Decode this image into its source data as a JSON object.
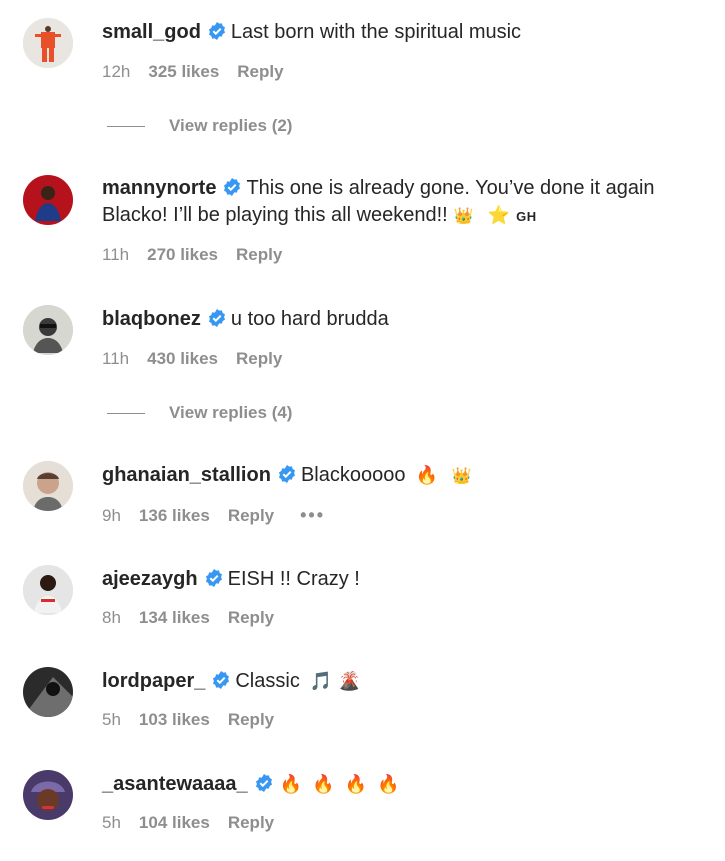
{
  "comments": [
    {
      "username": "small_god",
      "text": "Last born with the spiritual music",
      "time": "12h",
      "likes": "325 likes",
      "reply": "Reply",
      "view_replies": "View replies (2)"
    },
    {
      "username": "mannynorte",
      "text": "This one is already gone. You’ve done it again Blacko! I’ll be playing this all weekend!!",
      "emojis": [
        "👑",
        "⭐"
      ],
      "tag": "GH",
      "time": "11h",
      "likes": "270 likes",
      "reply": "Reply"
    },
    {
      "username": "blaqbonez",
      "text": "u too hard brudda",
      "time": "11h",
      "likes": "430 likes",
      "reply": "Reply",
      "view_replies": "View replies (4)"
    },
    {
      "username": "ghanaian_stallion",
      "text": "Blackooooo",
      "emojis": [
        "🔥",
        "👑"
      ],
      "time": "9h",
      "likes": "136 likes",
      "reply": "Reply",
      "more": "•••"
    },
    {
      "username": "ajeezaygh",
      "text": "EISH !! Crazy !",
      "time": "8h",
      "likes": "134 likes",
      "reply": "Reply"
    },
    {
      "username": "lordpaper_",
      "text": "Classic",
      "emojis": [
        "🎵",
        "🌋"
      ],
      "time": "5h",
      "likes": "103 likes",
      "reply": "Reply"
    },
    {
      "username": "_asantewaaaa_",
      "text": "",
      "emojis": [
        "🔥",
        "🔥",
        "🔥",
        "🔥"
      ],
      "time": "5h",
      "likes": "104 likes",
      "reply": "Reply"
    }
  ],
  "icons": {
    "verified": "verified-badge-icon",
    "more": "more-options-icon"
  },
  "colors": {
    "verified": "#3897f0",
    "meta": "#8e8e8e",
    "text": "#262626"
  }
}
